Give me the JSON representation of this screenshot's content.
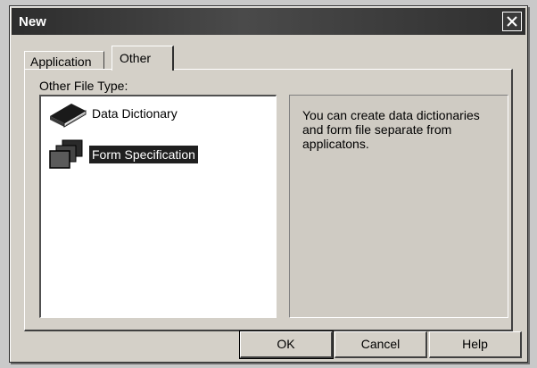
{
  "window": {
    "title": "New"
  },
  "tabs": [
    {
      "label": "Application",
      "active": false
    },
    {
      "label": "Other",
      "active": true
    }
  ],
  "panel": {
    "group_label": "Other File Type:",
    "items": [
      {
        "label": "Data Dictionary",
        "icon": "book-icon",
        "selected": false
      },
      {
        "label": "Form Specification",
        "icon": "stacked-forms-icon",
        "selected": true
      }
    ],
    "description": "You can create data dictionaries and form file separate from applicatons."
  },
  "buttons": {
    "ok": "OK",
    "cancel": "Cancel",
    "help": "Help"
  }
}
